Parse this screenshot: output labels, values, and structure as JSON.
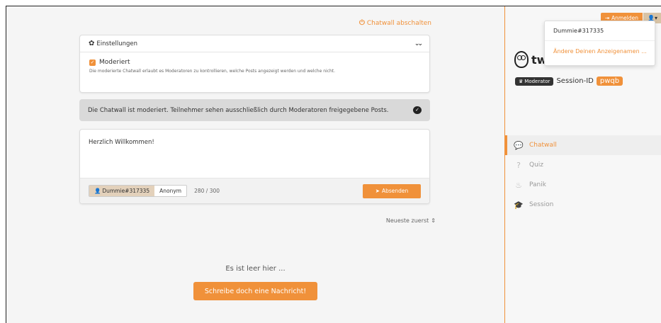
{
  "header": {
    "chatwall_off_label": "Chatwall abschalten"
  },
  "settings": {
    "title": "Einstellungen",
    "moderated_label": "Moderiert",
    "moderated_description": "Die moderierte Chatwall erlaubt es Moderatoren zu kontrollieren, welche Posts angezeigt werden und welche nicht."
  },
  "notice": {
    "text": "Die Chatwall ist moderiert. Teilnehmer sehen ausschließlich durch Moderatoren freigegebene Posts."
  },
  "compose": {
    "text": "Herzlich Willkommen!",
    "user_option": "Dummie#317335",
    "anon_option": "Anonym",
    "counter": "280 / 300",
    "send_label": "Absenden"
  },
  "sort": {
    "label": "Neueste zuerst"
  },
  "empty": {
    "text": "Es ist leer hier ...",
    "button_label": "Schreibe doch eine Nachricht!"
  },
  "sidebar": {
    "login_label": "Anmelden",
    "brand": "tweedback",
    "moderator_badge": "Moderator",
    "session_label": "Session-ID",
    "session_code": "pwqb",
    "nav": [
      {
        "label": "Chatwall",
        "icon": "chat-bubbles-icon",
        "active": true
      },
      {
        "label": "Quiz",
        "icon": "question-icon",
        "active": false
      },
      {
        "label": "Panik",
        "icon": "flame-icon",
        "active": false
      },
      {
        "label": "Session",
        "icon": "graduation-cap-icon",
        "active": false
      }
    ]
  },
  "user_menu": {
    "username": "Dummie#317335",
    "rename_label": "Ändere Deinen Anzeigenamen ..."
  },
  "colors": {
    "accent": "#f0913a",
    "sidebar_border": "#f0913a"
  }
}
